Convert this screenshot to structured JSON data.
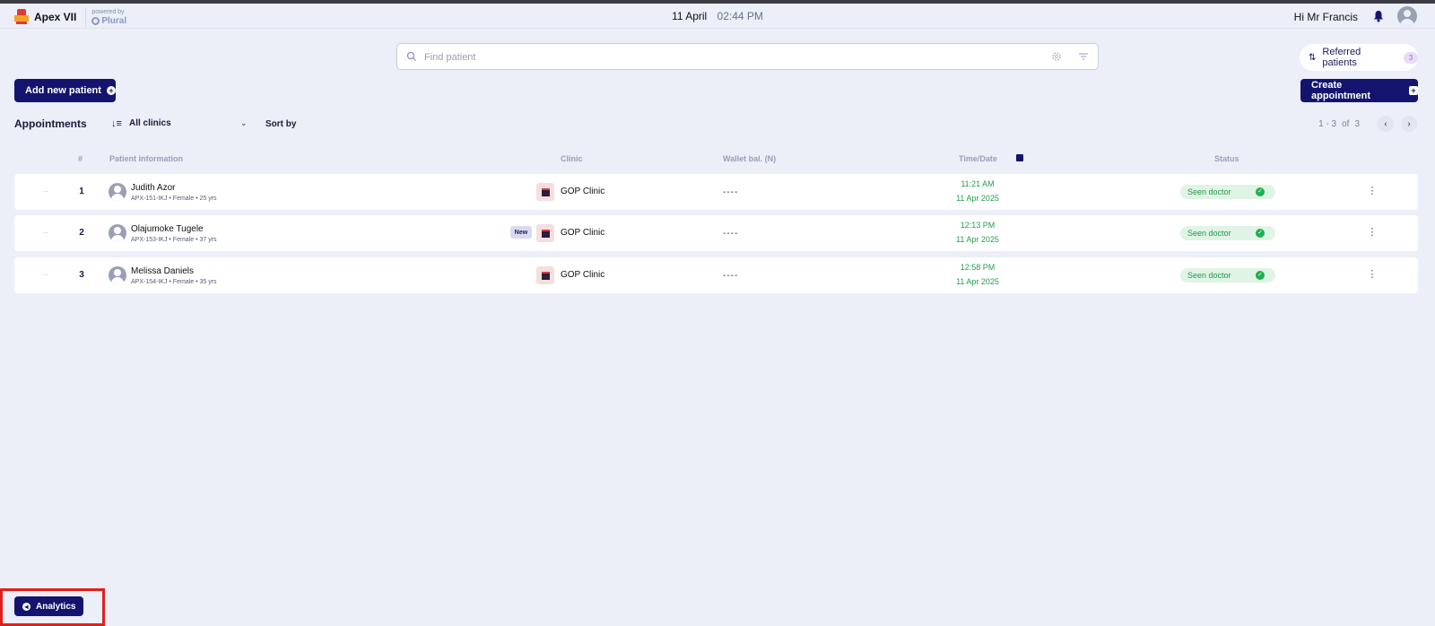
{
  "header": {
    "brand_name": "Apex VII",
    "powered_by": "powered by",
    "partner": "Plural",
    "date": "11 April",
    "time": "02:44 PM",
    "greeting": "Hi Mr Francis"
  },
  "search": {
    "placeholder": "Find patient"
  },
  "referred": {
    "label": "Referred patients",
    "count": "3"
  },
  "actions": {
    "add_patient": "Add new patient",
    "create_appointment": "Create appointment"
  },
  "toolbar": {
    "title": "Appointments",
    "clinic_filter": "All clinics",
    "sort_by": "Sort by"
  },
  "pagination": {
    "range": "1 - 3",
    "of": "of",
    "total": "3",
    "prev": "‹",
    "next": "›"
  },
  "table": {
    "headers": {
      "index": "#",
      "patient": "Patient information",
      "clinic": "Clinic",
      "wallet": "Wallet bal. (N)",
      "time": "Time/Date",
      "status": "Status"
    },
    "rows": [
      {
        "index": "1",
        "name": "Judith Azor",
        "meta": "APX-151-IKJ • Female • 25 yrs",
        "is_new": false,
        "clinic": "GOP Clinic",
        "wallet": "----",
        "time": "11:21 AM",
        "date": "11 Apr 2025",
        "status": "Seen doctor"
      },
      {
        "index": "2",
        "name": "Olajumoke Tugele",
        "meta": "APX-153-IKJ • Female • 37 yrs",
        "is_new": true,
        "new_label": "New",
        "clinic": "GOP Clinic",
        "wallet": "----",
        "time": "12:13 PM",
        "date": "11 Apr 2025",
        "status": "Seen doctor"
      },
      {
        "index": "3",
        "name": "Melissa Daniels",
        "meta": "APX-154-IKJ • Female • 35 yrs",
        "is_new": false,
        "clinic": "GOP Clinic",
        "wallet": "----",
        "time": "12:58 PM",
        "date": "11 Apr 2025",
        "status": "Seen doctor"
      }
    ]
  },
  "footer": {
    "analytics": "Analytics"
  },
  "colors": {
    "primary": "#14146e",
    "background": "#eceef8",
    "success": "#1f9a46",
    "highlight": "#e0201a"
  }
}
